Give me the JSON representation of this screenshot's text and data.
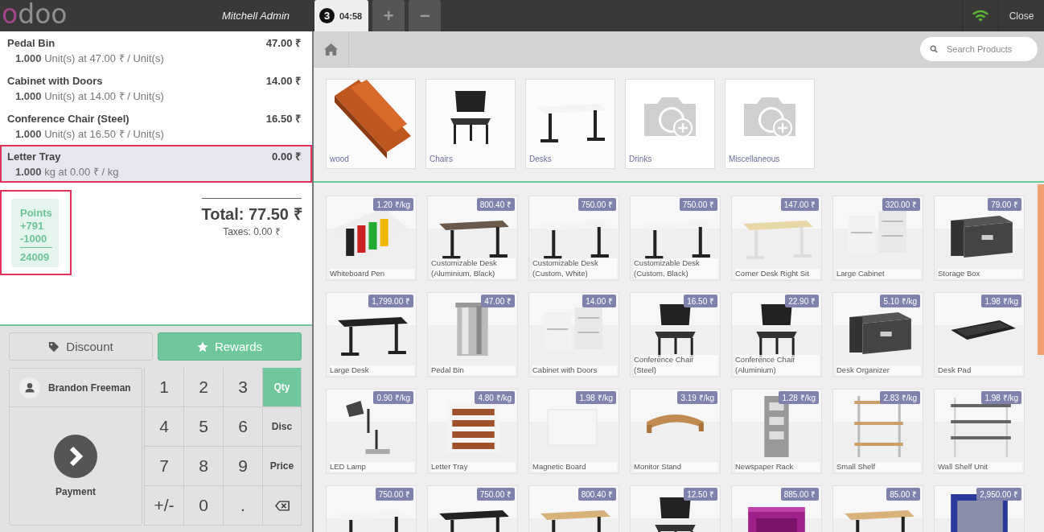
{
  "topbar": {
    "logo": "odoo",
    "user": "Mitchell Admin",
    "orders": [
      {
        "number": "3",
        "time": "04:58",
        "selected": true
      }
    ],
    "add_order": "+",
    "remove_order": "−",
    "close": "Close"
  },
  "search": {
    "placeholder": "Search Products"
  },
  "categories": [
    {
      "name": "wood",
      "kind": "picture"
    },
    {
      "name": "Chairs",
      "kind": "picture"
    },
    {
      "name": "Desks",
      "kind": "picture"
    },
    {
      "name": "Drinks",
      "kind": "placeholder"
    },
    {
      "name": "Miscellaneous",
      "kind": "placeholder"
    }
  ],
  "order_lines": [
    {
      "name": "Pedal Bin",
      "price": "47.00 ₹",
      "detail": "**1.000** Unit(s) at 47.00 ₹ / Unit(s)",
      "selected": false
    },
    {
      "name": "Cabinet with Doors",
      "price": "14.00 ₹",
      "detail": "**1.000** Unit(s) at 14.00 ₹ / Unit(s)",
      "selected": false
    },
    {
      "name": "Conference Chair (Steel)",
      "price": "16.50 ₹",
      "detail": "**1.000** Unit(s) at 16.50 ₹ / Unit(s)",
      "selected": false
    },
    {
      "name": "Letter Tray",
      "price": "0.00 ₹",
      "detail": "**1.000** kg at 0.00 ₹ / kg",
      "selected": true
    }
  ],
  "points": {
    "title": "Points",
    "won": "+791",
    "spent": "-1000",
    "total": "24009",
    "highlighted": true
  },
  "total": {
    "label": "Total: 77.50 ₹",
    "taxes": "Taxes: 0.00 ₹"
  },
  "actions": [
    {
      "label": "Discount",
      "kind": "discount",
      "active": false
    },
    {
      "label": "Rewards",
      "kind": "rewards",
      "active": true
    }
  ],
  "customer": "Brandon Freeman",
  "payment": "Payment",
  "keys": [
    {
      "label": "1",
      "kind": "digit"
    },
    {
      "label": "2",
      "kind": "digit"
    },
    {
      "label": "3",
      "kind": "digit"
    },
    {
      "label": "Qty",
      "kind": "mode",
      "selected": true
    },
    {
      "label": "4",
      "kind": "digit"
    },
    {
      "label": "5",
      "kind": "digit"
    },
    {
      "label": "6",
      "kind": "digit"
    },
    {
      "label": "Disc",
      "kind": "mode",
      "selected": false
    },
    {
      "label": "7",
      "kind": "digit"
    },
    {
      "label": "8",
      "kind": "digit"
    },
    {
      "label": "9",
      "kind": "digit"
    },
    {
      "label": "Price",
      "kind": "mode",
      "selected": false
    },
    {
      "label": "+/-",
      "kind": "digit"
    },
    {
      "label": "0",
      "kind": "digit"
    },
    {
      "label": ".",
      "kind": "digit"
    },
    {
      "kind": "backspace"
    }
  ],
  "products": [
    {
      "name": "Whiteboard Pen",
      "price": "1.20 ₹/kg"
    },
    {
      "name": "Customizable Desk (Aluminium, Black)",
      "price": "800.40 ₹"
    },
    {
      "name": "Customizable Desk (Custom, White)",
      "price": "750.00 ₹"
    },
    {
      "name": "Customizable Desk (Custom, Black)",
      "price": "750.00 ₹"
    },
    {
      "name": "Corner Desk Right Sit",
      "price": "147.00 ₹"
    },
    {
      "name": "Large Cabinet",
      "price": "320.00 ₹"
    },
    {
      "name": "Storage Box",
      "price": "79.00 ₹"
    },
    {
      "name": "Large Desk",
      "price": "1,799.00 ₹"
    },
    {
      "name": "Pedal Bin",
      "price": "47.00 ₹"
    },
    {
      "name": "Cabinet with Doors",
      "price": "14.00 ₹"
    },
    {
      "name": "Conference Chair (Steel)",
      "price": "16.50 ₹"
    },
    {
      "name": "Conference Chair (Aluminium)",
      "price": "22.90 ₹"
    },
    {
      "name": "Desk Organizer",
      "price": "5.10 ₹/kg"
    },
    {
      "name": "Desk Pad",
      "price": "1.98 ₹/kg"
    },
    {
      "name": "LED Lamp",
      "price": "0.90 ₹/kg"
    },
    {
      "name": "Letter Tray",
      "price": "4.80 ₹/kg"
    },
    {
      "name": "Magnetic Board",
      "price": "1.98 ₹/kg"
    },
    {
      "name": "Monitor Stand",
      "price": "3.19 ₹/kg"
    },
    {
      "name": "Newspaper Rack",
      "price": "1.28 ₹/kg"
    },
    {
      "name": "Small Shelf",
      "price": "2.83 ₹/kg"
    },
    {
      "name": "Wall Shelf Unit",
      "price": "1.98 ₹/kg"
    },
    {
      "price": "750.00 ₹"
    },
    {
      "price": "750.00 ₹"
    },
    {
      "price": "800.40 ₹"
    },
    {
      "price": "12.50 ₹"
    },
    {
      "price": "885.00 ₹"
    },
    {
      "price": "85.00 ₹"
    },
    {
      "price": "2,950.00 ₹"
    }
  ]
}
